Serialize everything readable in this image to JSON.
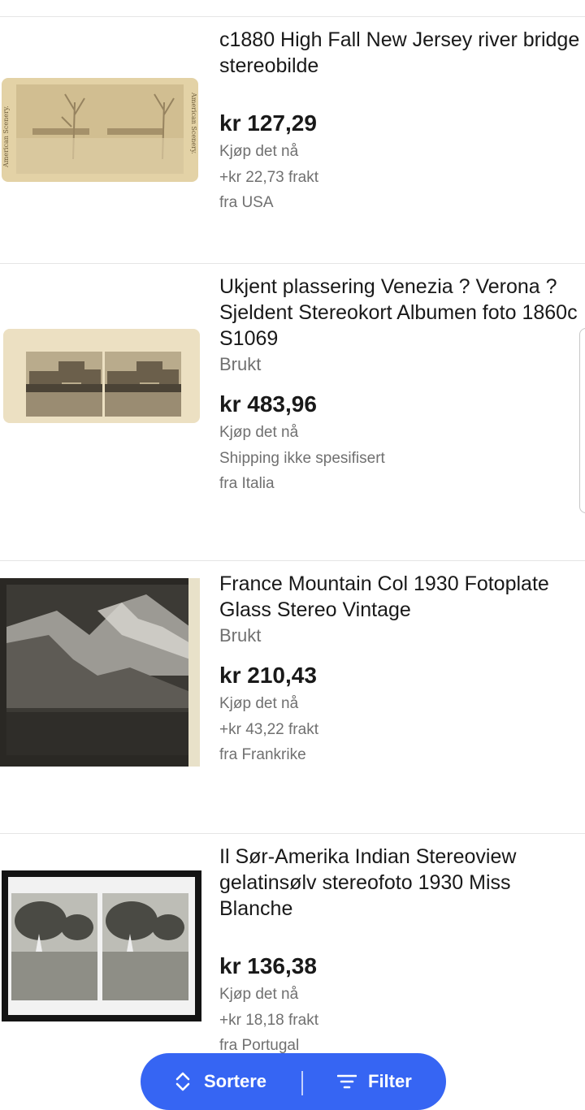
{
  "listings": [
    {
      "title": "c1880 High Fall New Jersey river bridge stereobilde",
      "condition": "",
      "price": "kr 127,29",
      "buy_format": "Kjøp det nå",
      "shipping": "+kr 22,73 frakt",
      "origin": "fra USA",
      "thumb_side_left": "American Scenery.",
      "thumb_side_right": "American Scenery."
    },
    {
      "title": "Ukjent plassering Venezia ? Verona ? Sjeldent Stereokort Albumen foto 1860c S1069",
      "condition": "Brukt",
      "price": "kr 483,96",
      "buy_format": "Kjøp det nå",
      "shipping": "Shipping ikke spesifisert",
      "origin": "fra Italia"
    },
    {
      "title": "France Mountain Col 1930 Fotoplate Glass Stereo Vintage",
      "condition": "Brukt",
      "price": "kr 210,43",
      "buy_format": "Kjøp det nå",
      "shipping": "+kr 43,22 frakt",
      "origin": "fra Frankrike"
    },
    {
      "title": "Il Sør-Amerika Indian Stereoview gelatinsølv stereofoto 1930 Miss Blanche",
      "condition": "",
      "price": "kr 136,38",
      "buy_format": "Kjøp det nå",
      "shipping": "+kr 18,18 frakt",
      "origin": "fra Portugal"
    }
  ],
  "bottom_bar": {
    "sort_label": "Sortere",
    "filter_label": "Filter",
    "sort_icon": "sort-chevrons-icon",
    "filter_icon": "filter-lines-icon"
  },
  "colors": {
    "accent": "#3665f3",
    "text_primary": "#191919",
    "text_secondary": "#707070",
    "divider": "#e5e5e5"
  }
}
